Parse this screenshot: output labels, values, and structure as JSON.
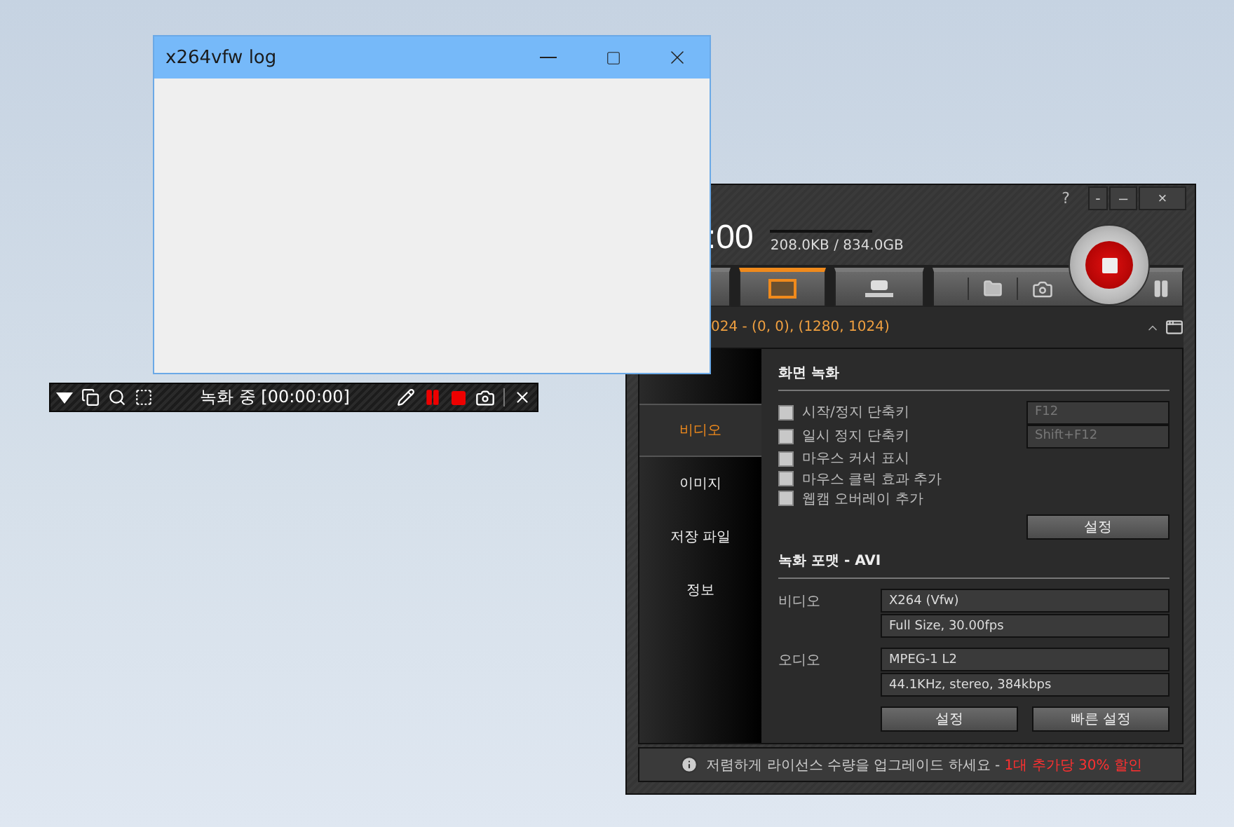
{
  "log_window": {
    "title": "x264vfw log"
  },
  "floating_toolbar": {
    "status": "녹화 중 [00:00:00]"
  },
  "app": {
    "help": "?",
    "window_buttons": [
      "-",
      "–",
      "×"
    ],
    "timer": ":00",
    "storage": "208.0KB / 834.0GB",
    "mode_tabs": [
      {
        "kind": "screen",
        "selected": true
      },
      {
        "kind": "device",
        "selected": false
      }
    ],
    "capture_info": "024 - (0, 0), (1280, 1024)",
    "sidebar": [
      {
        "label": "비디오",
        "selected": true
      },
      {
        "label": "이미지",
        "selected": false
      },
      {
        "label": "저장 파일",
        "selected": false
      },
      {
        "label": "정보",
        "selected": false
      }
    ],
    "section_title": "화면 녹화",
    "options": [
      {
        "label": "시작/정지 단축키",
        "checked": false,
        "hotkey": "F12"
      },
      {
        "label": "일시 정지 단축키",
        "checked": false,
        "hotkey": "Shift+F12"
      },
      {
        "label": "마우스 커서 표시",
        "checked": false
      },
      {
        "label": "마우스 클릭 효과 추가",
        "checked": false
      },
      {
        "label": "웹캠 오버레이 추가",
        "checked": false
      }
    ],
    "options_button": "설정",
    "format_title": "녹화 포맷 - AVI",
    "format_rows": [
      {
        "label": "비디오",
        "codec": "X264 (Vfw)",
        "detail": "Full Size, 30.00fps"
      },
      {
        "label": "오디오",
        "codec": "MPEG-1 L2",
        "detail": "44.1KHz, stereo, 384kbps"
      }
    ],
    "format_buttons": [
      "설정",
      "빠른 설정"
    ],
    "footer": {
      "text": "저렴하게 라이선스 수량을 업그레이드 하세요 -",
      "highlight": "1대 추가당 30% 할인"
    }
  }
}
